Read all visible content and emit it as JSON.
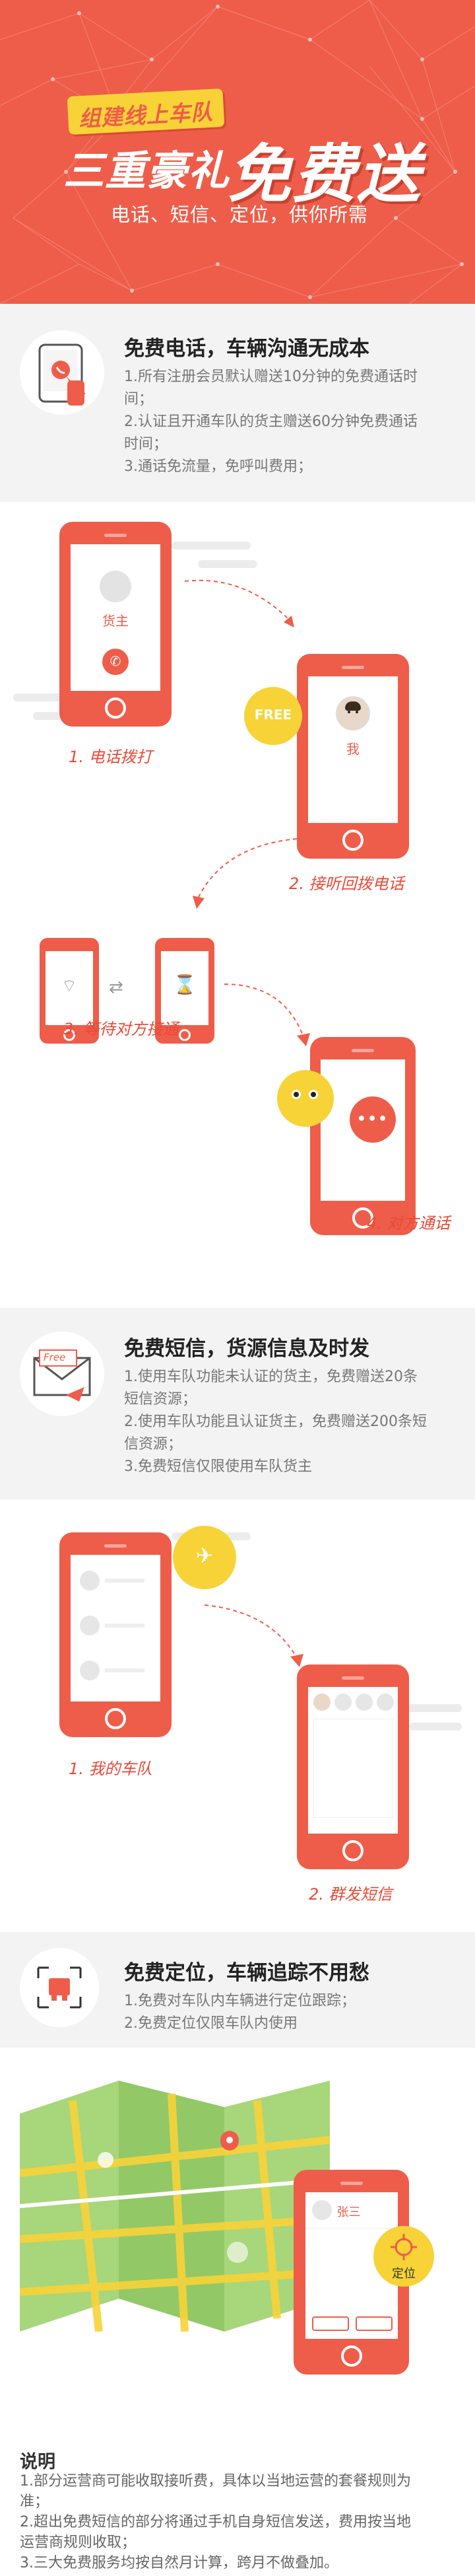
{
  "hero": {
    "badge": "组建线上车队",
    "title_prefix": "三重豪礼",
    "title_main": "免费送",
    "subtitle": "电话、短信、定位，供你所需"
  },
  "section_call": {
    "title": "免费电话，车辆沟通无成本",
    "lines": [
      "1.所有注册会员默认赠送10分钟的免费通话时",
      "间；",
      "2.认证且开通车队的货主赠送60分钟免费通话",
      "时间；",
      "3.通话免流量，免呼叫费用；"
    ],
    "icon": "phone-call-icon"
  },
  "call_flow": {
    "caller_name": "货主",
    "callee_name": "我",
    "free_badge": "FREE",
    "steps": [
      "1. 电话拨打",
      "2. 接听回拨电话",
      "3. 等待对方接通",
      "4. 对方通话"
    ]
  },
  "section_sms": {
    "title": "免费短信，货源信息及时发",
    "lines": [
      "1.使用车队功能未认证的货主，免费赠送20条",
      "短信资源；",
      "2.使用车队功能且认证货主，免费赠送200条短",
      "信资源；",
      "3.免费短信仅限使用车队货主"
    ],
    "envelope_text": "Free",
    "icon": "envelope-icon"
  },
  "sms_flow": {
    "steps": [
      "1. 我的车队",
      "2. 群发短信"
    ]
  },
  "section_loc": {
    "title": "免费定位，车辆追踪不用愁",
    "lines": [
      "1.免费对车队内车辆进行定位跟踪；",
      "2.免费定位仅限车队内使用"
    ],
    "icon": "truck-locate-icon"
  },
  "loc_flow": {
    "contact_name": "张三",
    "locate_label": "定位"
  },
  "notes": {
    "title": "说明",
    "lines": [
      "1.部分运营商可能收取接听费，具体以当地运营的套餐规则为",
      "准；",
      "2.超出免费短信的部分将通过手机自身短信发送，费用按当地",
      "运营商规则收取；",
      "3.三大免费服务均按自然月计算，跨月不做叠加。"
    ]
  },
  "colors": {
    "brand_red": "#ee5d4a",
    "badge_yellow": "#f7d338",
    "band_gray": "#f3f3f3"
  }
}
